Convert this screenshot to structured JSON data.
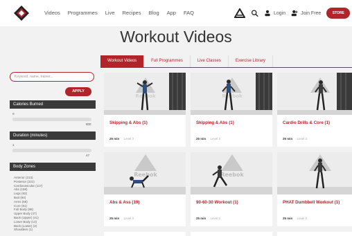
{
  "nav": {
    "links": [
      "Videos",
      "Programmes",
      "Live",
      "Recipes",
      "Blog",
      "App",
      "FAQ"
    ],
    "login": "Login",
    "join": "Join Free",
    "store": "STORE",
    "icons": [
      "brand-logo-icon",
      "reebok-icon",
      "search-icon",
      "login-user-icon",
      "join-user-icon"
    ]
  },
  "page": {
    "title": "Workout Videos"
  },
  "tabs": [
    "Workout Videos",
    "Full Programmes",
    "Live Classes",
    "Exercise Library"
  ],
  "active_tab": 0,
  "sidebar": {
    "search_placeholder": "Keyword, name, trainer...",
    "apply": "APPLY",
    "calories": {
      "title": "Calories Burned",
      "min": "0",
      "max": "800"
    },
    "duration": {
      "title": "Duration (minutes)",
      "min": "1",
      "max": "47"
    },
    "body_zones": {
      "title": "Body Zones",
      "items": [
        "Anterior (213)",
        "Posterior (221)",
        "Cardiovascular (117)",
        "Abs (158)",
        "Legs (83)",
        "Butt (84)",
        "Arms (68)",
        "Core (81)",
        "Full Body (88)",
        "Upper Body (47)",
        "Back (Upper) (41)",
        "Lower Body (13)",
        "Back (Lower) (2)",
        "Shoulders (1)"
      ]
    }
  },
  "cards": [
    {
      "title": "Skipping & Abs (1)",
      "duration": "25 min",
      "level": "Level 3"
    },
    {
      "title": "Skipping & Abs (1)",
      "duration": "25 min",
      "level": "Level 3"
    },
    {
      "title": "Cardio Drills & Core (1)",
      "duration": "25 min",
      "level": "Level 3"
    },
    {
      "title": "Abs & Ass (19)",
      "duration": "25 min",
      "level": "Level 3"
    },
    {
      "title": "90-60-30 Workout (1)",
      "duration": "25 min",
      "level": "Level 3"
    },
    {
      "title": "PHAT Dumbbell Workout (1)",
      "duration": "25 min",
      "level": "Level 3"
    }
  ],
  "thumb_brand": "Reebok",
  "colors": {
    "accent": "#b1242a",
    "filter_header": "#3a3a3a",
    "background": "#f2f2f2"
  }
}
